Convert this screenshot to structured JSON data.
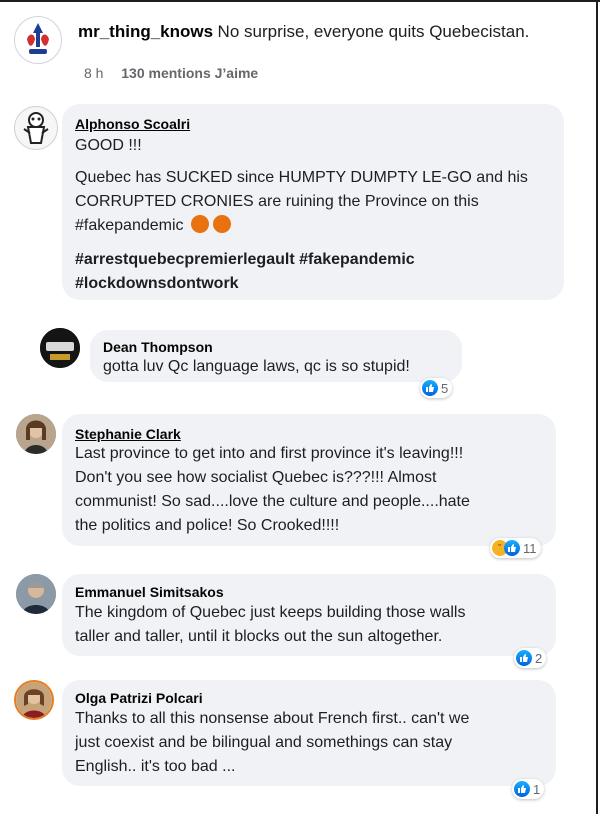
{
  "post": {
    "username": "mr_thing_knows",
    "caption": "No surprise, everyone quits Quebecistan.",
    "age": "8 h",
    "likes": "130 mentions J’aime"
  },
  "comments": [
    {
      "author": "Alphonso Scoalri",
      "lines": [
        "GOOD !!!",
        "Quebec has SUCKED since HUMPTY DUMPTY LE-GO and his",
        "CORRUPTED CRONIES are ruining the Province on this",
        "#fakepandemic"
      ],
      "hashtags": [
        "#arrestquebecpremierlegault #fakepandemic",
        "#lockdownsdontwork"
      ]
    },
    {
      "author": "Dean Thompson",
      "lines": [
        "gotta luv Qc language laws, qc is so stupid!"
      ],
      "reaction_count": "5"
    },
    {
      "author": "Stephanie Clark",
      "lines": [
        "Last province to get into and first province it's leaving!!!",
        "Don't you see how socialist Quebec is???!!! Almost",
        "communist! So sad....love the culture and people....hate",
        "the politics and police! So Crooked!!!!"
      ],
      "reaction_count": "11"
    },
    {
      "author": "Emmanuel Simitsakos",
      "lines": [
        "The kingdom of Quebec just keeps building those walls",
        "taller and taller, until it blocks out the sun altogether."
      ],
      "reaction_count": "2"
    },
    {
      "author": "Olga Patrizi Polcari",
      "lines": [
        "Thanks to all this nonsense about French first.. can't we",
        "just coexist and be bilingual and somethings can stay",
        "English.. it's too bad ..."
      ],
      "reaction_count": "1"
    }
  ],
  "colors": {
    "bubble": "#f0f2f5",
    "like_blue": "#1877f2",
    "angry_red": "#e9710f"
  },
  "icons": [
    "like-icon",
    "haha-icon",
    "angry-emoji-icon"
  ]
}
